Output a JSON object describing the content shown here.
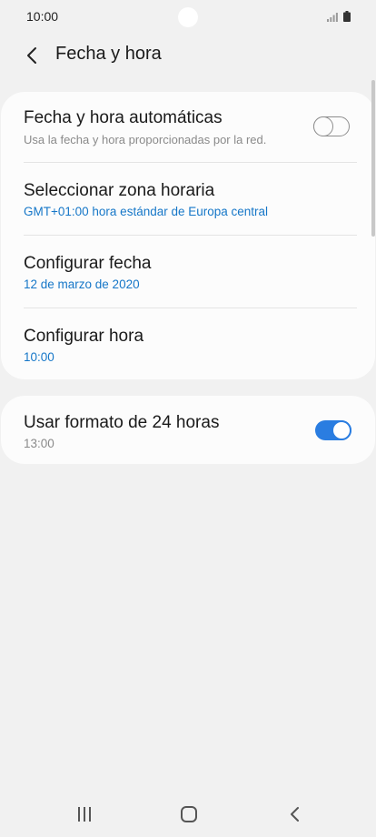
{
  "status_bar": {
    "time": "10:00"
  },
  "header": {
    "title": "Fecha y hora"
  },
  "settings": {
    "auto_datetime": {
      "title": "Fecha y hora automáticas",
      "subtitle": "Usa la fecha y hora proporcionadas por la red.",
      "enabled": false
    },
    "timezone": {
      "title": "Seleccionar zona horaria",
      "value": "GMT+01:00 hora estándar de Europa central"
    },
    "set_date": {
      "title": "Configurar fecha",
      "value": "12 de marzo de 2020"
    },
    "set_time": {
      "title": "Configurar hora",
      "value": "10:00"
    },
    "format_24h": {
      "title": "Usar formato de 24 horas",
      "subtitle": "13:00",
      "enabled": true
    }
  },
  "colors": {
    "accent": "#2a7de1",
    "value_text": "#1677c8",
    "background": "#f1f1f1",
    "card": "#fcfcfc"
  },
  "icons": {
    "back": "chevron-left-icon",
    "signal": "signal-icon",
    "battery": "battery-icon",
    "recents": "recents-icon",
    "home": "home-icon",
    "nav_back": "back-icon"
  }
}
